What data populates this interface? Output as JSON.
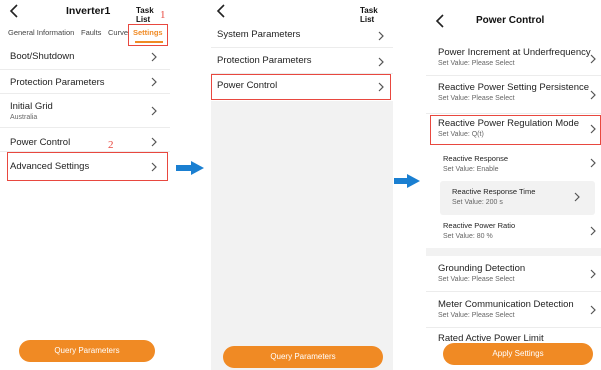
{
  "colors": {
    "accent": "#f08a24",
    "highlight": "#e8483f",
    "arrow": "#1a7fd1",
    "divider": "#ececec",
    "empty_area": "#f2f2f2"
  },
  "icons": {
    "back": "chevron-left-icon",
    "row": "chevron-right-icon",
    "flow": "arrow-right-icon"
  },
  "screen1": {
    "title": "Inverter1",
    "task_list": "Task List",
    "tabs": [
      "General Information",
      "Faults",
      "Curve",
      "Settings"
    ],
    "active_tab": "Settings",
    "marker_tab": "1",
    "marker_item": "2",
    "items": [
      {
        "label": "Boot/Shutdown"
      },
      {
        "label": "Protection Parameters"
      },
      {
        "label": "Initial Grid",
        "sub": "Australia"
      },
      {
        "label": "Power Control"
      },
      {
        "label": "Advanced Settings"
      }
    ],
    "button": "Query Parameters"
  },
  "screen2": {
    "task_list": "Task List",
    "items": [
      {
        "label": "System Parameters"
      },
      {
        "label": "Protection Parameters"
      },
      {
        "label": "Power Control"
      }
    ],
    "button": "Query Parameters"
  },
  "screen3": {
    "title": "Power Control",
    "items": [
      {
        "label": "Power Increment at Underfrequency",
        "sub": "Set Value: Please Select"
      },
      {
        "label": "Reactive Power Setting Persistence",
        "sub": "Set Value: Please Select"
      },
      {
        "label": "Reactive Power Regulation Mode",
        "sub": "Set Value: Q(t)"
      },
      {
        "label": "Reactive Response",
        "sub": "Set Value: Enable"
      },
      {
        "label": "Reactive Response Time",
        "sub": "Set Value: 200 s"
      },
      {
        "label": "Reactive Power Ratio",
        "sub": "Set Value: 80 %"
      },
      {
        "label": "Grounding Detection",
        "sub": "Set Value: Please Select"
      },
      {
        "label": "Meter Communication Detection",
        "sub": "Set Value: Please Select"
      },
      {
        "label": "Rated Active Power Limit"
      }
    ],
    "button": "Apply Settings"
  }
}
